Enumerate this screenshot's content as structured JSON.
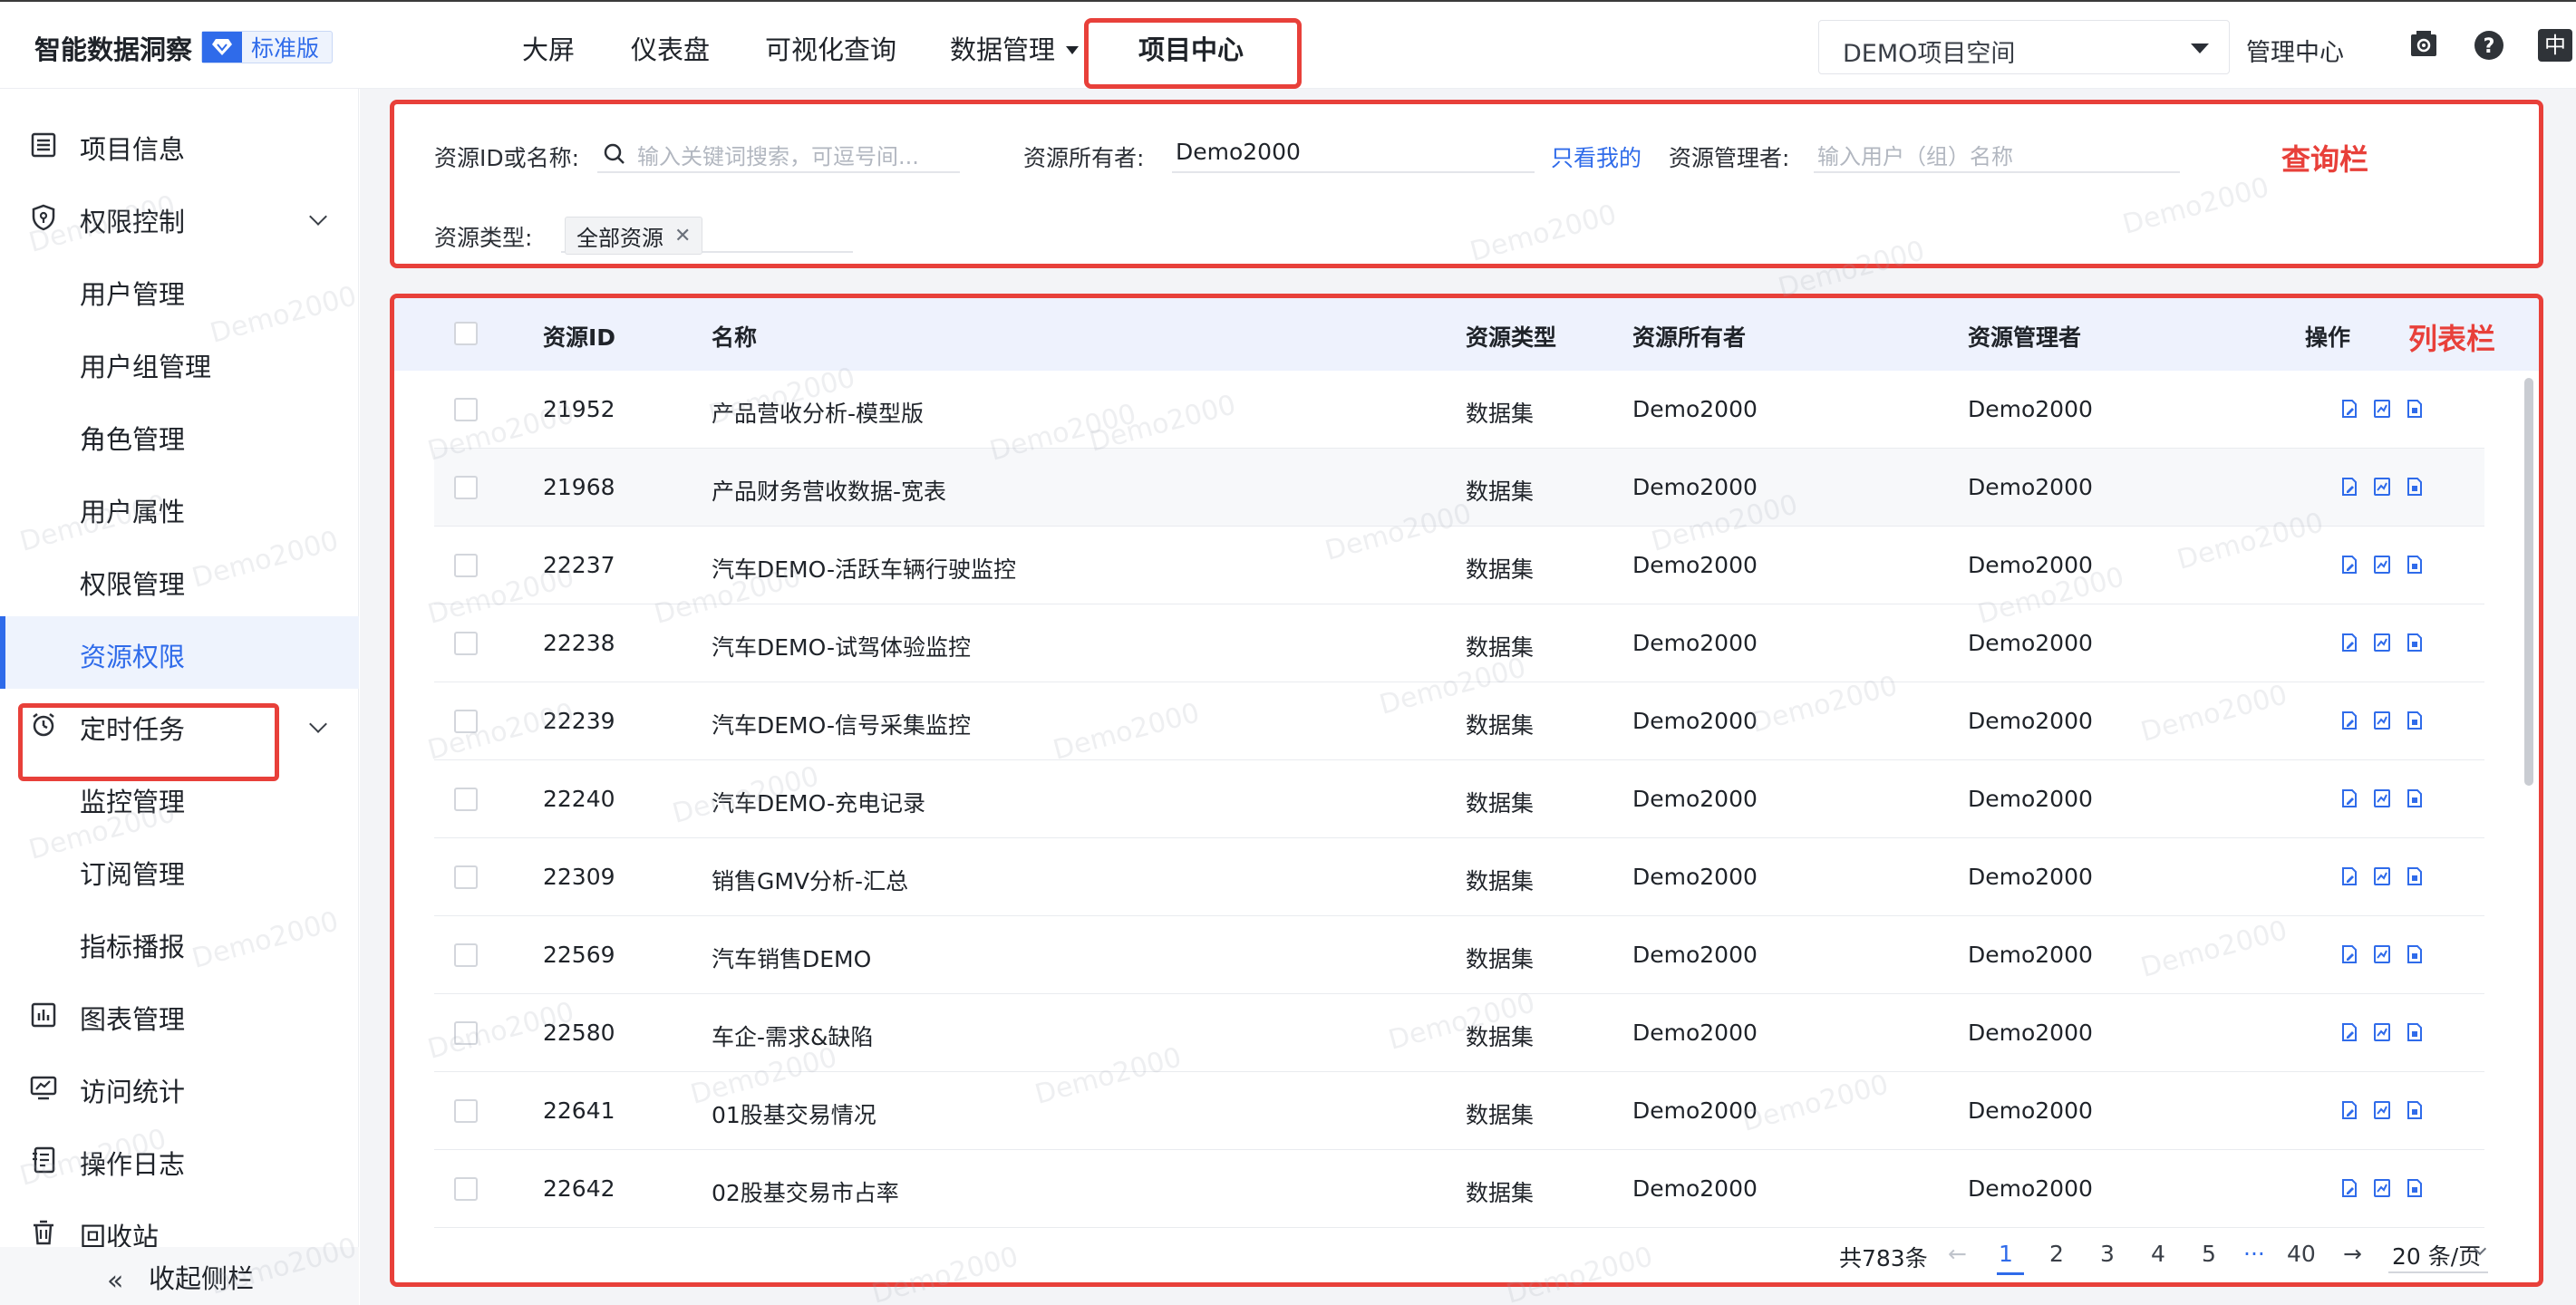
{
  "brand": {
    "title": "智能数据洞察",
    "edition": "标准版"
  },
  "nav": {
    "items": [
      "大屏",
      "仪表盘",
      "可视化查询",
      "数据管理",
      "项目中心"
    ],
    "active": "项目中心"
  },
  "header": {
    "space_select": "DEMO项目空间",
    "admin_center": "管理中心",
    "lang": "中"
  },
  "sidebar": {
    "items": [
      {
        "label": "项目信息",
        "icon": "list-icon"
      },
      {
        "label": "权限控制",
        "icon": "shield-icon"
      },
      {
        "label": "用户管理"
      },
      {
        "label": "用户组管理"
      },
      {
        "label": "角色管理"
      },
      {
        "label": "用户属性"
      },
      {
        "label": "权限管理"
      },
      {
        "label": "资源权限"
      },
      {
        "label": "定时任务",
        "icon": "alarm-clock-icon"
      },
      {
        "label": "监控管理"
      },
      {
        "label": "订阅管理"
      },
      {
        "label": "指标播报"
      },
      {
        "label": "图表管理",
        "icon": "bar-chart-icon"
      },
      {
        "label": "访问统计",
        "icon": "monitor-chart-icon"
      },
      {
        "label": "操作日志",
        "icon": "log-icon"
      },
      {
        "label": "回收站",
        "icon": "trash-icon"
      }
    ],
    "active": "资源权限",
    "collapse_label": "收起侧栏"
  },
  "query": {
    "id_label": "资源ID或名称:",
    "id_placeholder": "输入关键词搜索，可逗号间...",
    "owner_label": "资源所有者:",
    "owner_value": "Demo2000",
    "only_mine": "只看我的",
    "manager_label": "资源管理者:",
    "manager_placeholder": "输入用户（组）名称",
    "type_label": "资源类型:",
    "type_tag": "全部资源",
    "annotation": "查询栏"
  },
  "table": {
    "annotation": "列表栏",
    "columns": [
      "资源ID",
      "名称",
      "资源类型",
      "资源所有者",
      "资源管理者",
      "操作"
    ],
    "rows": [
      [
        "21952",
        "产品营收分析-模型版",
        "数据集",
        "Demo2000",
        "Demo2000"
      ],
      [
        "21968",
        "产品财务营收数据-宽表",
        "数据集",
        "Demo2000",
        "Demo2000"
      ],
      [
        "22237",
        "汽车DEMO-活跃车辆行驶监控",
        "数据集",
        "Demo2000",
        "Demo2000"
      ],
      [
        "22238",
        "汽车DEMO-试驾体验监控",
        "数据集",
        "Demo2000",
        "Demo2000"
      ],
      [
        "22239",
        "汽车DEMO-信号采集监控",
        "数据集",
        "Demo2000",
        "Demo2000"
      ],
      [
        "22240",
        "汽车DEMO-充电记录",
        "数据集",
        "Demo2000",
        "Demo2000"
      ],
      [
        "22309",
        "销售GMV分析-汇总",
        "数据集",
        "Demo2000",
        "Demo2000"
      ],
      [
        "22569",
        "汽车销售DEMO",
        "数据集",
        "Demo2000",
        "Demo2000"
      ],
      [
        "22580",
        "车企-需求&缺陷",
        "数据集",
        "Demo2000",
        "Demo2000"
      ],
      [
        "22641",
        "01股基交易情况",
        "数据集",
        "Demo2000",
        "Demo2000"
      ],
      [
        "22642",
        "02股基交易市占率",
        "数据集",
        "Demo2000",
        "Demo2000"
      ]
    ]
  },
  "pagination": {
    "total": "共783条",
    "pages": [
      "1",
      "2",
      "3",
      "4",
      "5",
      "···",
      "40"
    ],
    "current": "1",
    "page_size": "20 条/页"
  },
  "watermark": "Demo2000"
}
